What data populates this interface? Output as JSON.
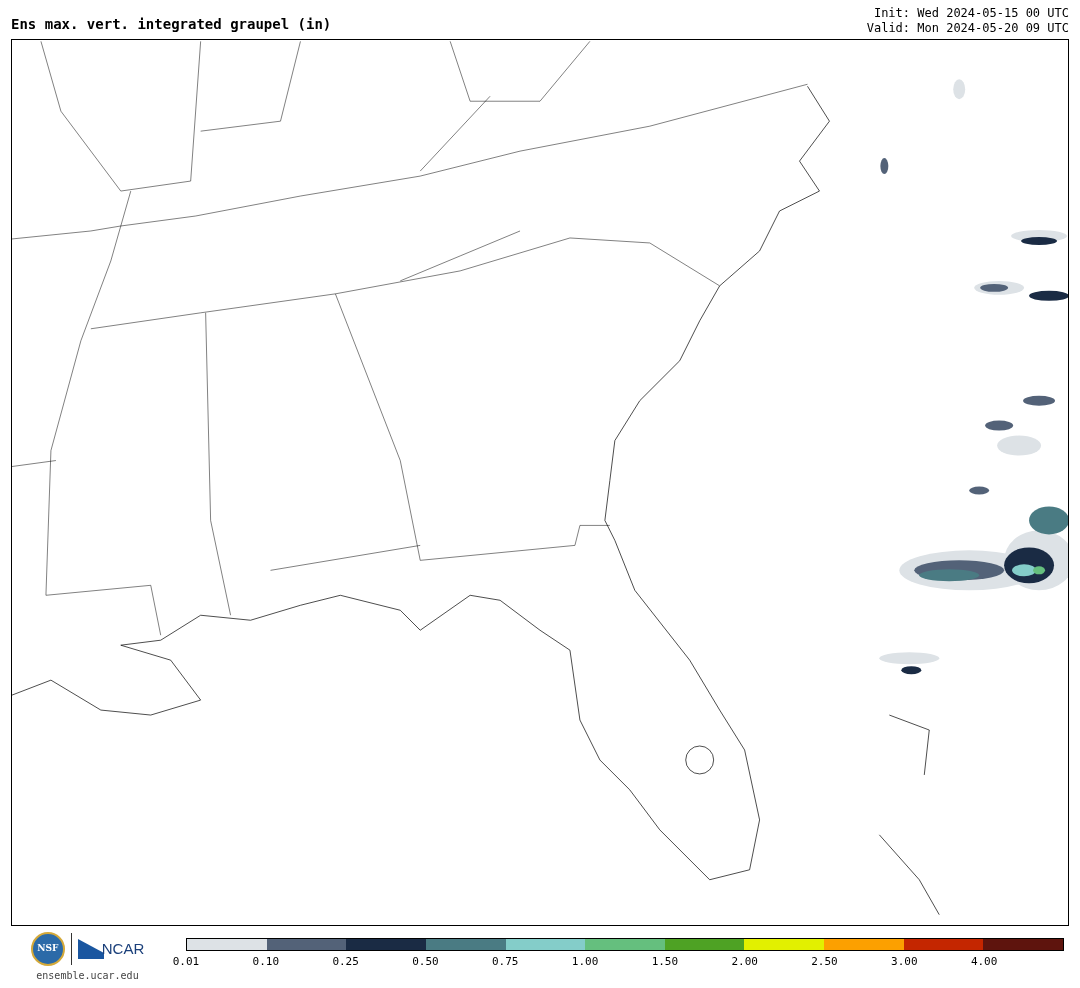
{
  "title": "Ens max. vert. integrated graupel (in)",
  "init": "Init: Wed 2024-05-15 00 UTC",
  "valid": "Valid: Mon 2024-05-20 09 UTC",
  "logos": {
    "nsf": "NSF",
    "ncar": "NCAR",
    "site": "ensemble.ucar.edu"
  },
  "colorbar": [
    {
      "label": "0.01",
      "color": "#dde2e6"
    },
    {
      "label": "0.10",
      "color": "#536278"
    },
    {
      "label": "0.25",
      "color": "#1a2b44"
    },
    {
      "label": "0.50",
      "color": "#4a7b83"
    },
    {
      "label": "0.75",
      "color": "#84cdc9"
    },
    {
      "label": "1.00",
      "color": "#65bf7e"
    },
    {
      "label": "1.50",
      "color": "#4ea224"
    },
    {
      "label": "2.00",
      "color": "#e2f000"
    },
    {
      "label": "2.50",
      "color": "#fca000"
    },
    {
      "label": "3.00",
      "color": "#c42600"
    },
    {
      "label": "4.00",
      "color": "#5e140d"
    }
  ]
}
